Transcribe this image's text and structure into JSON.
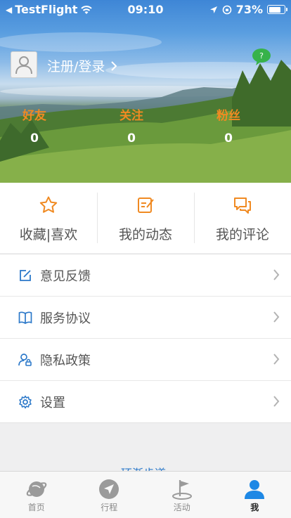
{
  "status_bar": {
    "back_app": "TestFlight",
    "time": "09:10",
    "battery": "73%"
  },
  "profile": {
    "login_text": "注册/登录",
    "stats": [
      {
        "label": "好友",
        "value": "0"
      },
      {
        "label": "关注",
        "value": "0"
      },
      {
        "label": "粉丝",
        "value": "0"
      }
    ]
  },
  "actions": [
    {
      "label": "收藏|喜欢",
      "icon": "star-icon"
    },
    {
      "label": "我的动态",
      "icon": "edit-note-icon"
    },
    {
      "label": "我的评论",
      "icon": "comment-icon"
    }
  ],
  "menu": [
    {
      "label": "意见反馈",
      "icon": "feedback-icon"
    },
    {
      "label": "服务协议",
      "icon": "book-icon"
    },
    {
      "label": "隐私政策",
      "icon": "user-lock-icon"
    },
    {
      "label": "设置",
      "icon": "gear-icon"
    }
  ],
  "peek_text": "环渐步道",
  "tabs": [
    {
      "label": "首页",
      "icon": "planet-icon",
      "active": false
    },
    {
      "label": "行程",
      "icon": "navigation-icon",
      "active": false
    },
    {
      "label": "活动",
      "icon": "flag-icon",
      "active": false
    },
    {
      "label": "我",
      "icon": "person-icon",
      "active": true
    }
  ],
  "colors": {
    "accent_orange": "#f08a22",
    "accent_blue": "#2b78c9",
    "tab_active": "#1e88e5",
    "tab_inactive": "#8a8a8a"
  }
}
